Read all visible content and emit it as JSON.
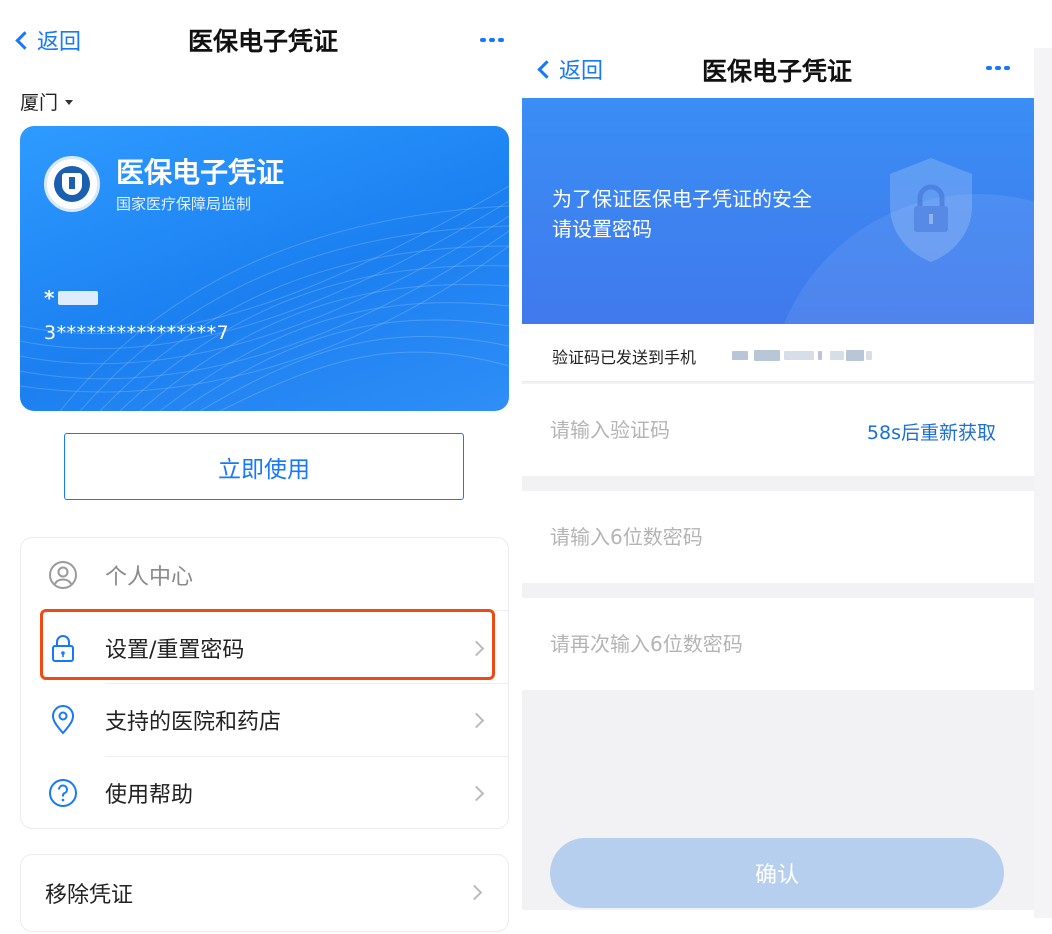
{
  "left": {
    "nav": {
      "back_label": "返回",
      "title": "医保电子凭证"
    },
    "city": "厦门",
    "card": {
      "title": "医保电子凭证",
      "subtitle": "国家医疗保障局监制",
      "name_prefix": "*",
      "id_masked": "3****************7"
    },
    "use_now_label": "立即使用",
    "menu": {
      "items": [
        {
          "label": "个人中心",
          "icon": "user-circle-icon"
        },
        {
          "label": "设置/重置密码",
          "icon": "lock-icon"
        },
        {
          "label": "支持的医院和药店",
          "icon": "location-pin-icon"
        },
        {
          "label": "使用帮助",
          "icon": "help-circle-icon"
        }
      ]
    },
    "remove_label": "移除凭证"
  },
  "right": {
    "nav": {
      "back_label": "返回",
      "title": "医保电子凭证"
    },
    "banner": {
      "line1": "为了保证医保电子凭证的安全",
      "line2": "请设置密码",
      "icon": "shield-lock-icon"
    },
    "sent_label": "验证码已发送到手机",
    "code_placeholder": "请输入验证码",
    "resend_label": "58s后重新获取",
    "password_placeholder": "请输入6位数密码",
    "password_confirm_placeholder": "请再次输入6位数密码",
    "confirm_label": "确认"
  },
  "colors": {
    "accent": "#1677ff",
    "highlight": "#f04a14",
    "confirm_disabled": "#b7cfee"
  }
}
